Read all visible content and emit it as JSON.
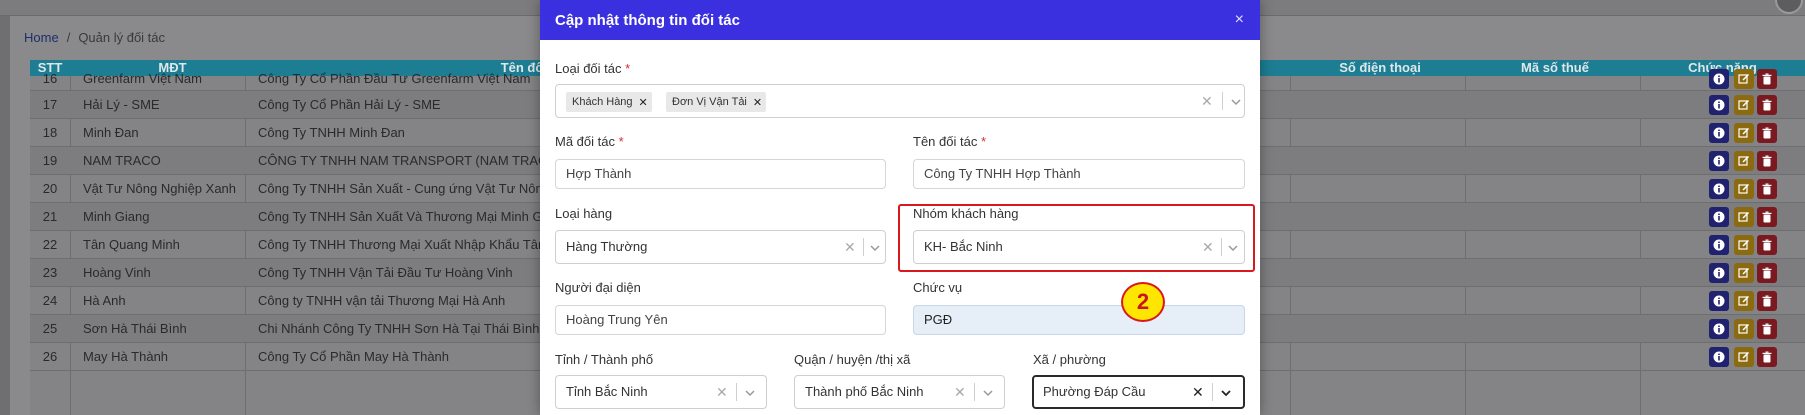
{
  "breadcrumb": {
    "home": "Home",
    "separator": "/",
    "current": "Quản lý đối tác"
  },
  "table": {
    "headers": {
      "stt": "STT",
      "mdt": "MĐT",
      "ten": "Tên đối tác",
      "sdt": "Số điện thoại",
      "mst": "Mã số thuế",
      "chucnang": "Chức năng"
    },
    "rows": [
      {
        "stt": "16",
        "mdt": "Greenfarm Việt Nam",
        "ten": "Công Ty Cổ Phần Đầu Tư Greenfarm Việt Nam"
      },
      {
        "stt": "17",
        "mdt": "Hải Lý - SME",
        "ten": "Công Ty Cổ Phần Hải Lý - SME"
      },
      {
        "stt": "18",
        "mdt": "Minh Đan",
        "ten": "Công Ty TNHH Minh Đan"
      },
      {
        "stt": "19",
        "mdt": "NAM TRACO",
        "ten": "CÔNG TY TNHH NAM TRANSPORT (NAM TRACO)"
      },
      {
        "stt": "20",
        "mdt": "Vật Tư Nông Nghiệp Xanh",
        "ten": "Công Ty TNHH Sản Xuất - Cung ứng Vật Tư Nông N"
      },
      {
        "stt": "21",
        "mdt": "Minh Giang",
        "ten": "Công Ty TNHH Sản Xuất  Và Thương Mại Minh Gian"
      },
      {
        "stt": "22",
        "mdt": "Tân Quang Minh",
        "ten": "Công Ty TNHH Thương Mại Xuất Nhập Khẩu Tân Q"
      },
      {
        "stt": "23",
        "mdt": "Hoàng Vinh",
        "ten": "Công Ty TNHH Vận Tải Đầu Tư Hoàng Vinh"
      },
      {
        "stt": "24",
        "mdt": "Hà Anh",
        "ten": "Công ty TNHH vận tải Thương Mại Hà Anh"
      },
      {
        "stt": "25",
        "mdt": "Sơn Hà Thái Bình",
        "ten": "Chi Nhánh Công Ty TNHH Sơn Hà Tại Thái Bình"
      },
      {
        "stt": "26",
        "mdt": "May Hà Thành",
        "ten": "Công Ty Cổ Phần May Hà Thành"
      }
    ]
  },
  "modal": {
    "title": "Cập nhật thông tin đối tác",
    "close": "×",
    "loai_doi_tac": {
      "label": "Loại đối tác",
      "required": "*",
      "chips": [
        "Khách Hàng",
        "Đơn Vị Vận Tải"
      ]
    },
    "ma_doi_tac": {
      "label": "Mã đối tác",
      "required": "*",
      "value": "Hợp Thành"
    },
    "ten_doi_tac": {
      "label": "Tên đối tác",
      "required": "*",
      "value": "Công Ty TNHH Hợp Thành"
    },
    "loai_hang": {
      "label": "Loại hàng",
      "value": "Hàng Thường"
    },
    "nhom_khach_hang": {
      "label": "Nhóm khách hàng",
      "value": "KH- Bắc Ninh"
    },
    "nguoi_dai_dien": {
      "label": "Người đại diện",
      "value": "Hoàng Trung Yên"
    },
    "chuc_vu": {
      "label": "Chức vụ",
      "value": "PGĐ"
    },
    "tinh": {
      "label": "Tỉnh / Thành phố",
      "value": "Tỉnh Bắc Ninh"
    },
    "quan": {
      "label": "Quận / huyện /thị xã",
      "value": "Thành phố Bắc Ninh"
    },
    "xa": {
      "label": "Xã / phường",
      "value": "Phường Đáp Cầu"
    }
  },
  "annotation": {
    "step": "2"
  },
  "colors": {
    "modal_header": "#3b30e0",
    "highlight": "#d8191f",
    "badge": "#ffe600"
  }
}
